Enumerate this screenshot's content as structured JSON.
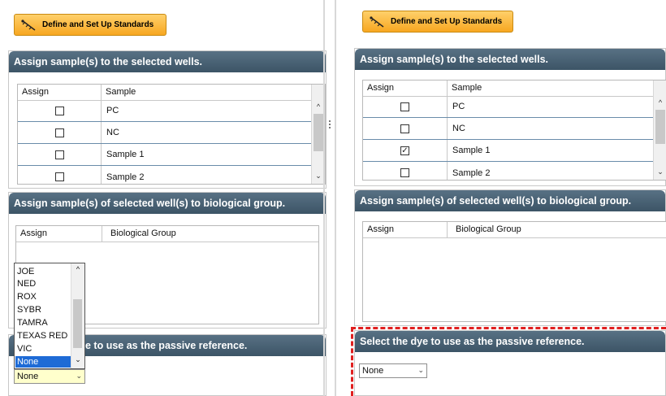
{
  "left": {
    "standards_button": "Define and Set Up Standards",
    "assign_section": {
      "title": "Assign sample(s) to the selected wells.",
      "columns": [
        "Assign",
        "Sample"
      ],
      "rows": [
        {
          "sample": "PC",
          "checked": false
        },
        {
          "sample": "NC",
          "checked": false
        },
        {
          "sample": "Sample 1",
          "checked": false
        },
        {
          "sample": "Sample 2",
          "checked": false
        }
      ]
    },
    "bio_section": {
      "title": "Assign sample(s) of selected well(s) to biological group.",
      "columns": [
        "Assign",
        "Biological Group"
      ]
    },
    "passive_section": {
      "title_visible": "e to use as the passive reference.",
      "select_value": "None"
    },
    "dropdown_options": [
      "JOE",
      "NED",
      "ROX",
      "SYBR",
      "TAMRA",
      "TEXAS RED",
      "VIC",
      "None"
    ],
    "dropdown_selected": "None"
  },
  "right": {
    "standards_button": "Define and Set Up Standards",
    "assign_section": {
      "title": "Assign sample(s) to the selected wells.",
      "columns": [
        "Assign",
        "Sample"
      ],
      "rows": [
        {
          "sample": "PC",
          "checked": false
        },
        {
          "sample": "NC",
          "checked": false
        },
        {
          "sample": "Sample 1",
          "checked": true
        },
        {
          "sample": "Sample 2",
          "checked": false
        }
      ]
    },
    "bio_section": {
      "title": "Assign sample(s) of selected well(s) to biological group.",
      "columns": [
        "Assign",
        "Biological Group"
      ]
    },
    "passive_section": {
      "title": "Select the dye to use as the passive reference.",
      "select_value": "None"
    }
  },
  "icons": {
    "standards": "ruler-icon",
    "scroll_up": "chevron-up-icon",
    "scroll_down": "chevron-down-icon",
    "select": "chevron-down-icon"
  },
  "colors": {
    "section_header": "#4a6377",
    "button": "#f7a721",
    "highlight": "#e02020",
    "selection": "#1e6bd6",
    "select_hover": "#ffffcc"
  }
}
